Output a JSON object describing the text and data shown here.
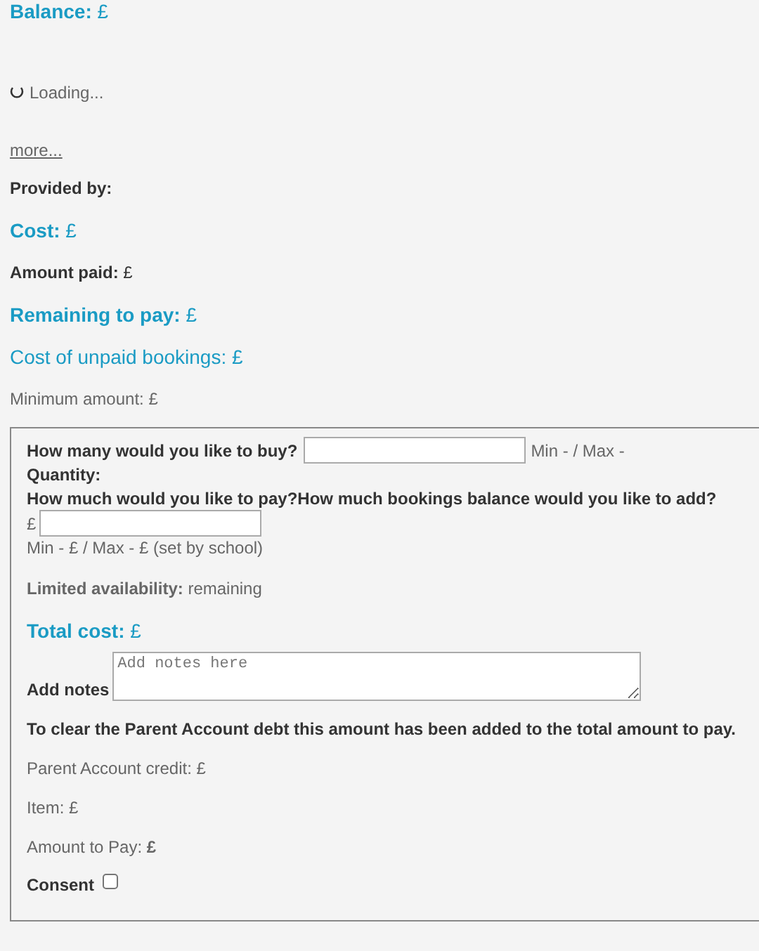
{
  "balance": "**Balance:** £",
  "loading": {
    "text": "Loading..."
  },
  "more_link": "more...",
  "summary": [
    {
      "kind": "strong",
      "text": "Provided by:"
    },
    {
      "kind": "accent",
      "text": "**Cost:** £"
    },
    {
      "kind": "label",
      "text": "**Amount paid:** £"
    },
    {
      "kind": "accent",
      "text": "**Remaining to pay:** £"
    },
    {
      "kind": "accent",
      "text": "Cost of unpaid bookings: £"
    },
    {
      "kind": "muted",
      "text": "Minimum amount: £"
    }
  ],
  "form": {
    "quantity_question": "How many would you like to buy?",
    "quantity_range": "Min - / Max -",
    "quantity_label": "Quantity:",
    "pay_question": "How much would you like to pay?How much bookings balance would you like to add?",
    "currency": "£",
    "amount_range": "Min - £ / Max - £ (set by school)",
    "availability": "**Limited availability:** remaining",
    "total": "**Total cost:** £",
    "notes": {
      "label": "Add notes",
      "placeholder": "Add notes here"
    },
    "debt_notice": "To clear the Parent Account debt this amount has been added to the total amount to pay.",
    "breakdown": [
      "Parent Account credit: £",
      "Item: £",
      "Amount to Pay: **£**"
    ],
    "consent": {
      "label": "Consent",
      "checked": false
    }
  }
}
